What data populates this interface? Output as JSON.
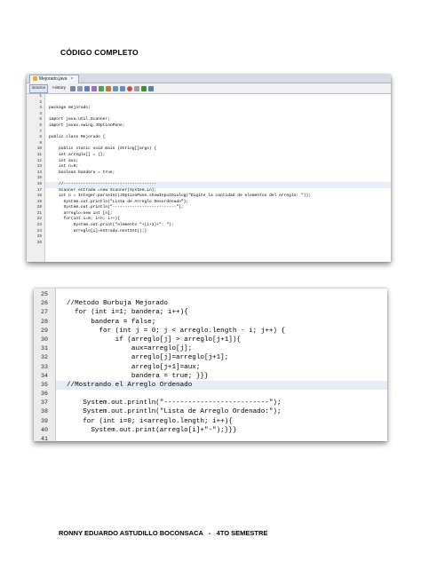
{
  "heading": "CÓDIGO COMPLETO",
  "footer": "RONNY EDUARDO ASTUDILLO BOCONSACA   -   4TO SEMESTRE",
  "editor": {
    "file_tab": "Mejorado.java",
    "toolbar": {
      "source": "Source",
      "history": "History"
    },
    "accent": "#f3a92e",
    "line_numbers": [
      "1",
      "2",
      "3",
      "4",
      "5",
      "6",
      "7",
      "8",
      "9",
      "10",
      "11",
      "12",
      "13",
      "14",
      "15",
      "16",
      "17",
      "18",
      "19",
      "20",
      "21",
      "22",
      "23",
      "24",
      "25",
      "26"
    ],
    "lines": [
      "",
      "",
      "package mejorado;",
      "",
      "import java.util.Scanner;",
      "import javax.swing.JOptionPane;",
      "",
      "public class Mejorado {",
      "",
      "    public static void main (String[]args) {",
      "    int arreglo[] = {};",
      "    int aux;",
      "    int n=0;",
      "    boolean bandera = true;",
      "",
      "    //--------------------------------------",
      "    Scanner entrada =new Scanner(System.in);",
      "    int n = Integer.parseInt(JOptionPane.showInputDialog(\"Digite la cantidad de elementos del Arreglo: \"));",
      "      System.out.println(\"Lista de Arreglo Desordenado\");",
      "      System.out.println(\"--------------------------\");",
      "      arreglo=new int [n];",
      "      for(int i=0; i<n; i++){",
      "          System.out.print(\"elemento \"+(i+1)+\": \");",
      "          arreglo[i]=entrada.nextInt();}",
      "",
      ""
    ]
  },
  "zoom": {
    "line_numbers": [
      "25",
      "26",
      "27",
      "28",
      "29",
      "30",
      "31",
      "32",
      "33",
      "34",
      "35",
      "36",
      "37",
      "38",
      "39",
      "40",
      "41"
    ],
    "lines": [
      "",
      "//Metodo Burbuja Mejorado",
      "  for (int i=1; bandera; i++){",
      "      bandera = false;",
      "        for (int j = 0; j < arreglo.length - i; j++) {",
      "            if (arreglo[j] > arreglo[j+1]){",
      "                aux=arreglo[j];",
      "                arreglo[j]=arreglo[j+1];",
      "                arreglo[j+1]=aux;",
      "                bandera = true; }}}",
      "//Mostrando el Arreglo Ordenado",
      "",
      "    System.out.println(\"--------------------------\");",
      "    System.out.println(\"Lista de Arreglo Ordenado:\");",
      "    for (int i=0; i<arreglo.length; i++){",
      "      System.out.print(arreglo[i]+\"-\");}}}",
      ""
    ]
  }
}
